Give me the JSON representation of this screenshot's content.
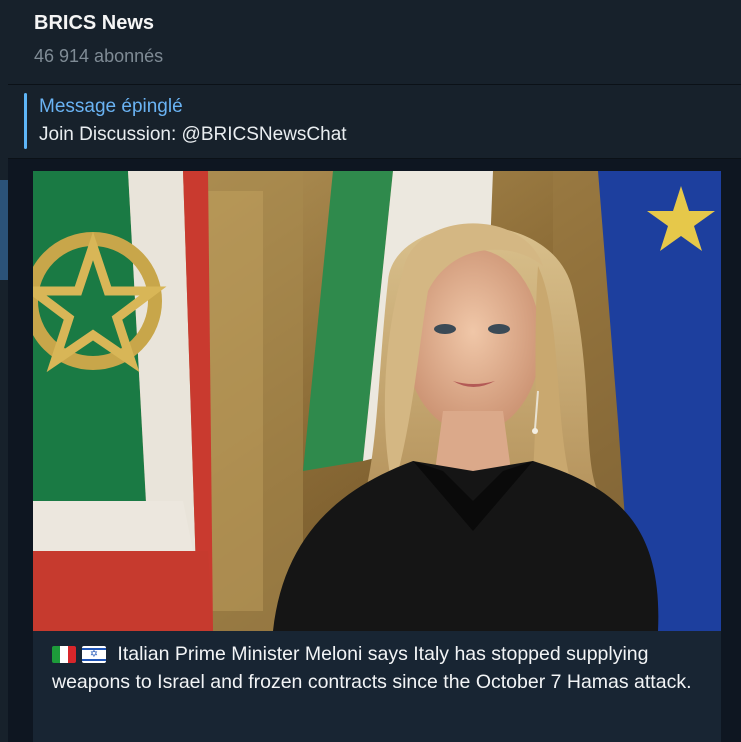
{
  "channel": {
    "title": "BRICS News",
    "subscribers": "46 914 abonnés"
  },
  "pinned": {
    "label": "Message épinglé",
    "text": "Join Discussion: @BRICSNewsChat"
  },
  "post": {
    "flags": [
      "flag-italy-icon",
      "flag-israel-icon"
    ],
    "caption": "Italian Prime Minister Meloni says Italy has stopped supplying weapons to Israel and frozen contracts since the October 7 Hamas attack."
  },
  "colors": {
    "accent": "#6ab3f3",
    "background": "#0e1621",
    "panel": "#17212b",
    "bubble": "#182533"
  }
}
